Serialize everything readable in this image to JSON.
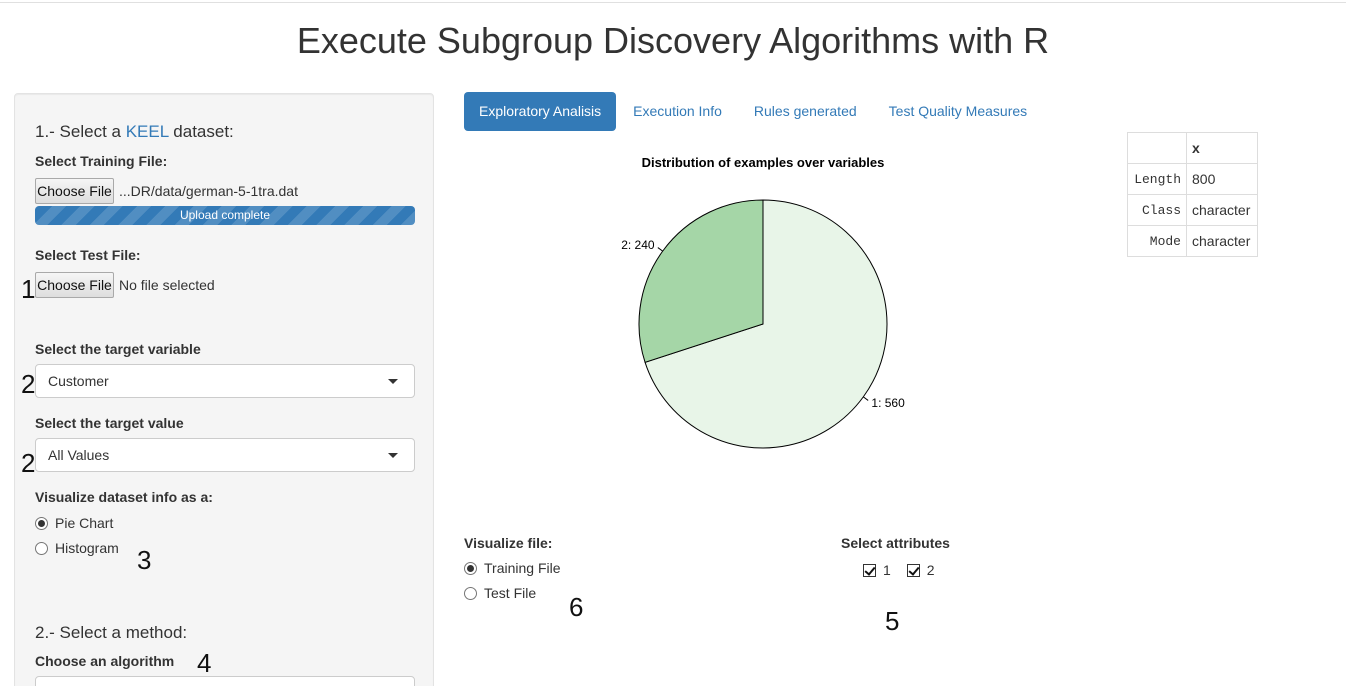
{
  "page": {
    "title": "Execute Subgroup Discovery Algorithms with R"
  },
  "sidebar": {
    "section1": {
      "prefix": "1.- Select a ",
      "link": "KEEL",
      "suffix": " dataset:"
    },
    "training_label": "Select Training File:",
    "training_button": "Choose File",
    "training_file": "...DR/data/german-5-1tra.dat",
    "upload_status": "Upload complete",
    "test_label": "Select Test File:",
    "test_button": "Choose File",
    "test_file": "No file selected",
    "target_variable_label": "Select the target variable",
    "target_variable_value": "Customer",
    "target_value_label": "Select the target value",
    "target_value_value": "All Values",
    "visualize_label": "Visualize dataset info as a:",
    "viz_options": [
      "Pie Chart",
      "Histogram"
    ],
    "viz_selected": "Pie Chart",
    "section2": "2.- Select a method:",
    "algorithm_label": "Choose an algorithm"
  },
  "markers": [
    "1",
    "2",
    "2",
    "3",
    "4",
    "5",
    "6"
  ],
  "tabs": [
    {
      "label": "Exploratory Analisis",
      "active": true
    },
    {
      "label": "Execution Info",
      "active": false
    },
    {
      "label": "Rules generated",
      "active": false
    },
    {
      "label": "Test Quality Measures",
      "active": false
    }
  ],
  "chart_data": {
    "type": "pie",
    "title": "Distribution of examples over variables",
    "labels": [
      "1: 560",
      "2: 240"
    ],
    "categories": [
      "1",
      "2"
    ],
    "values": [
      560,
      240
    ],
    "colors": [
      "#e8f5e8",
      "#a5d6a7"
    ]
  },
  "summary_table": {
    "header": "x",
    "rows": [
      {
        "key": "Length",
        "value": "800"
      },
      {
        "key": "Class",
        "value": "character"
      },
      {
        "key": "Mode",
        "value": "character"
      }
    ]
  },
  "visualize_file": {
    "label": "Visualize file:",
    "options": [
      "Training File",
      "Test File"
    ],
    "selected": "Training File"
  },
  "attributes": {
    "label": "Select attributes",
    "options": [
      "1",
      "2"
    ],
    "checked": [
      "1",
      "2"
    ]
  }
}
